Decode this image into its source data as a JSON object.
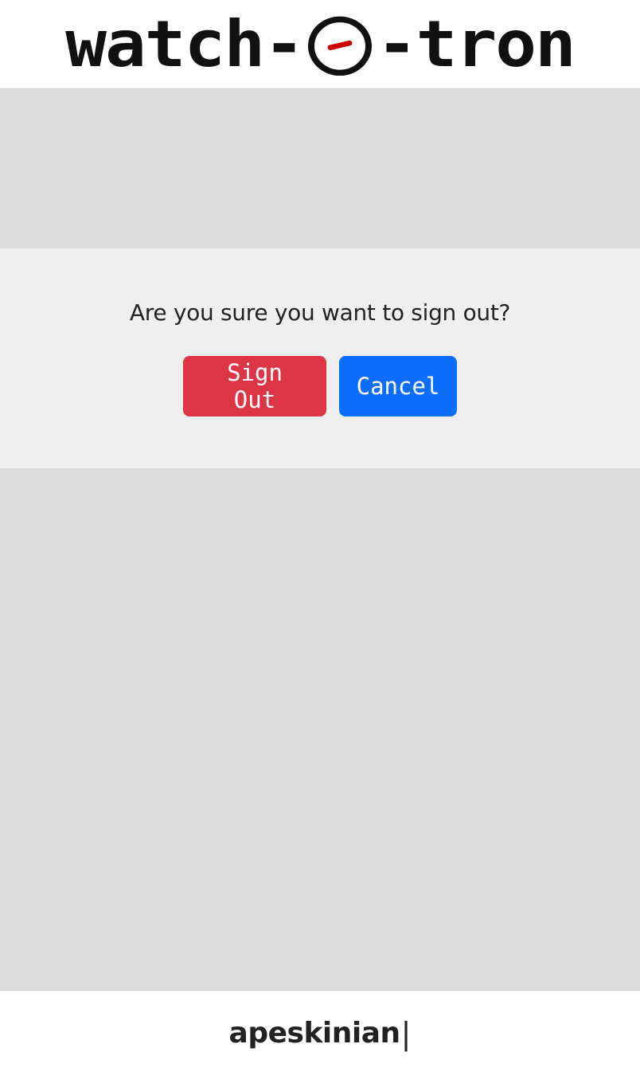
{
  "header": {
    "logo_left": "watch-",
    "logo_right": "-tron",
    "logo_icon": "clock-icon",
    "logo_hand_color": "#cc0000"
  },
  "dialog": {
    "message": "Are you sure you want to sign out?",
    "confirm_label": "Sign Out",
    "cancel_label": "Cancel",
    "confirm_color": "#dc3545",
    "cancel_color": "#0d6efd"
  },
  "footer": {
    "username": "apeskinian",
    "cursor": "|"
  }
}
